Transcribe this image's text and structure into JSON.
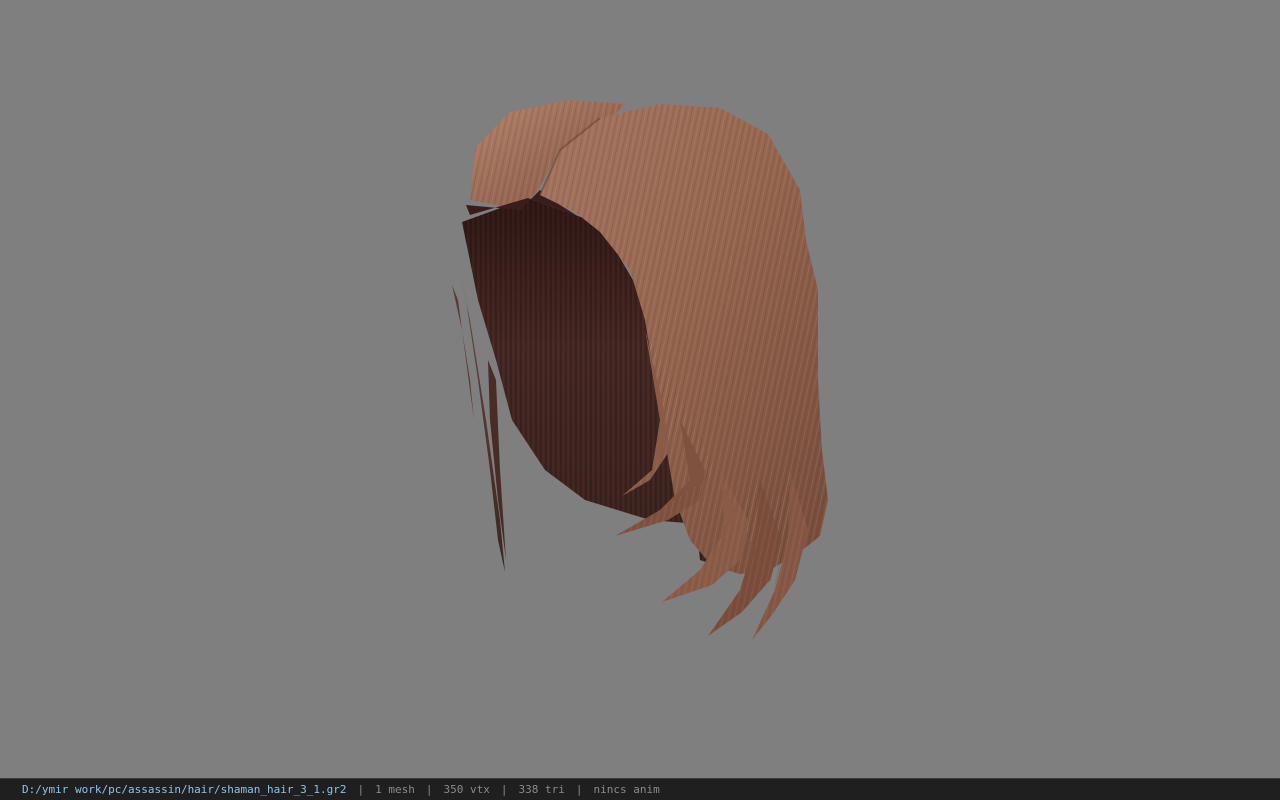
{
  "viewer": {
    "background_color": "#7f7f7f",
    "model_name": "shaman hair mesh",
    "hair_colors": {
      "highlight": "#a87a63",
      "mid": "#8d5f4b",
      "dark": "#3e2420",
      "shadow": "#2a1614"
    }
  },
  "status_bar": {
    "file_path": "D:/ymir work/pc/assassin/hair/shaman_hair_3_1.gr2",
    "separator": "|",
    "mesh_count": "1 mesh",
    "vertex_count": "350 vtx",
    "triangle_count": "338 tri",
    "animation_status": "nincs anim",
    "path_color": "#8fc3e6"
  }
}
